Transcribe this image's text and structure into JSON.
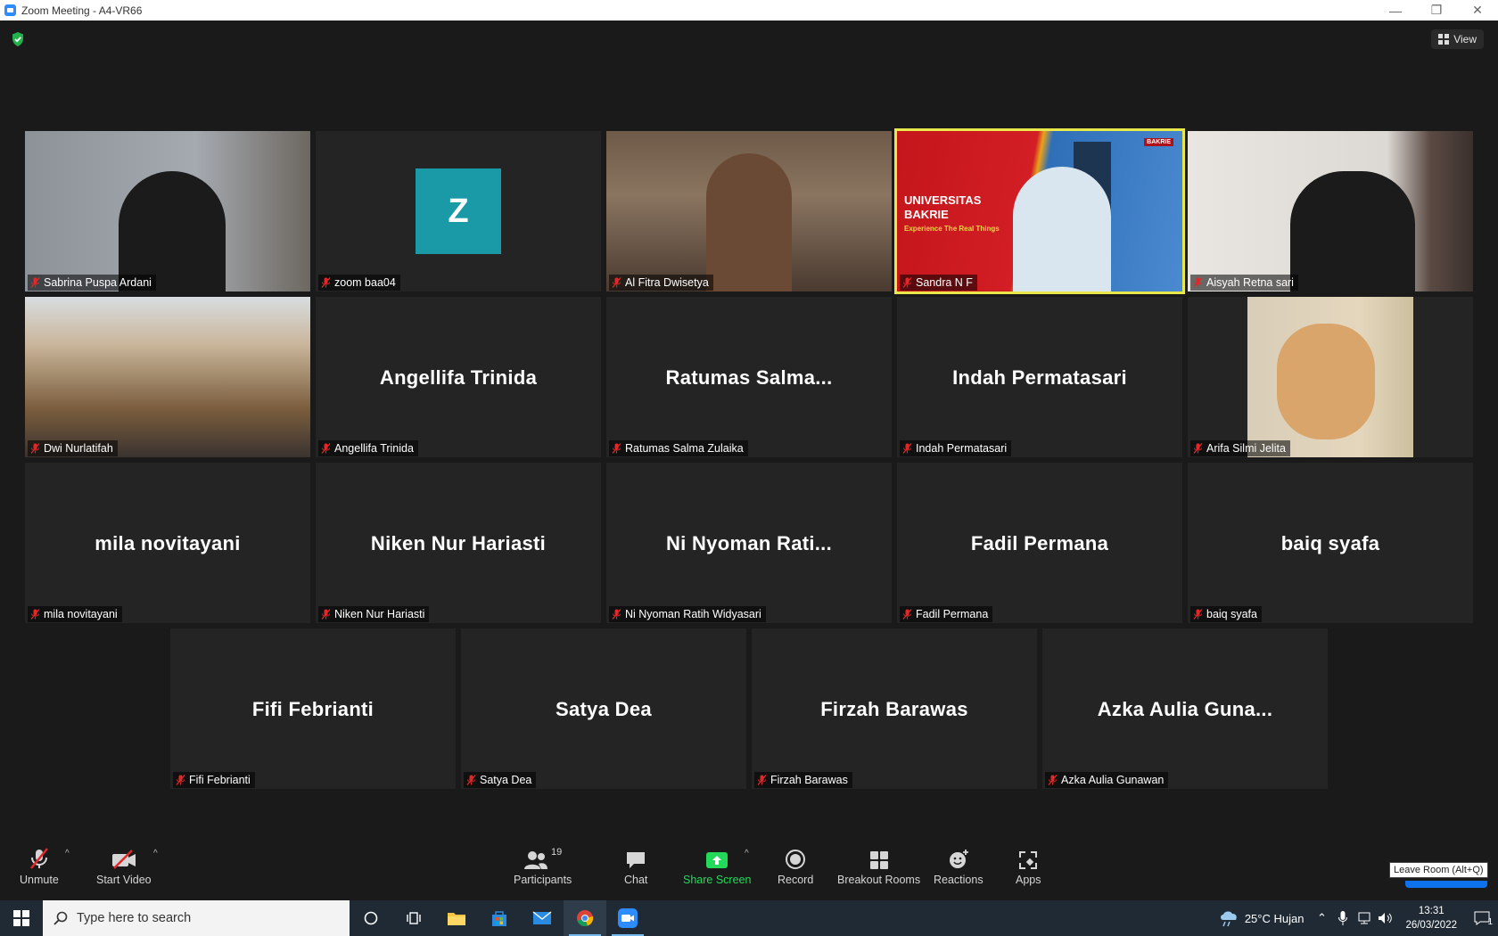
{
  "window": {
    "title": "Zoom Meeting - A4-VR66"
  },
  "view_button": {
    "label": "View"
  },
  "participants": [
    {
      "display": "video",
      "name": "Sabrina Puspa Ardani"
    },
    {
      "display": "avatar",
      "initial": "Z",
      "name": "zoom baa04"
    },
    {
      "display": "video",
      "name": "Al Fitra Dwisetya"
    },
    {
      "display": "share",
      "name": "Sandra N F",
      "slide_title_1": "UNIVERSITAS",
      "slide_title_2": "BAKRIE",
      "slide_subtitle": "Experience The Real Things",
      "logo_text": "BAKRIE"
    },
    {
      "display": "video",
      "name": "Aisyah Retna sari"
    },
    {
      "display": "video",
      "name": "Dwi Nurlatifah"
    },
    {
      "display": "name",
      "big": "Angellifa Trinida",
      "name": "Angellifa Trinida"
    },
    {
      "display": "name",
      "big": "Ratumas  Salma...",
      "name": "Ratumas Salma Zulaika"
    },
    {
      "display": "name",
      "big": "Indah Permatasari",
      "name": "Indah Permatasari"
    },
    {
      "display": "video",
      "name": "Arifa Silmi Jelita"
    },
    {
      "display": "name",
      "big": "mila novitayani",
      "name": "mila novitayani"
    },
    {
      "display": "name",
      "big": "Niken Nur Hariasti",
      "name": "Niken Nur Hariasti"
    },
    {
      "display": "name",
      "big": "Ni  Nyoman Rati...",
      "name": "Ni Nyoman Ratih Widyasari"
    },
    {
      "display": "name",
      "big": "Fadil Permana",
      "name": "Fadil Permana"
    },
    {
      "display": "name",
      "big": "baiq syafa",
      "name": "baiq syafa"
    },
    {
      "display": "name",
      "big": "Fifi Febrianti",
      "name": "Fifi Febrianti"
    },
    {
      "display": "name",
      "big": "Satya Dea",
      "name": "Satya Dea"
    },
    {
      "display": "name",
      "big": "Firzah Barawas",
      "name": "Firzah Barawas"
    },
    {
      "display": "name",
      "big": "Azka  Aulia Guna...",
      "name": "Azka Aulia Gunawan"
    }
  ],
  "toolbar": {
    "unmute": "Unmute",
    "start_video": "Start Video",
    "participants": "Participants",
    "participants_count": "19",
    "chat": "Chat",
    "share_screen": "Share Screen",
    "record": "Record",
    "breakout_rooms": "Breakout Rooms",
    "reactions": "Reactions",
    "apps": "Apps",
    "leave_tooltip": "Leave Room (Alt+Q)"
  },
  "taskbar": {
    "search_placeholder": "Type here to search",
    "weather": "25°C  Hujan",
    "time": "13:31",
    "date": "26/03/2022",
    "notifications": "1"
  },
  "colors": {
    "share_green": "#23d959",
    "active_border": "#e8e84a",
    "avatar_teal": "#1a9aa7",
    "mute_red": "#e02828"
  }
}
